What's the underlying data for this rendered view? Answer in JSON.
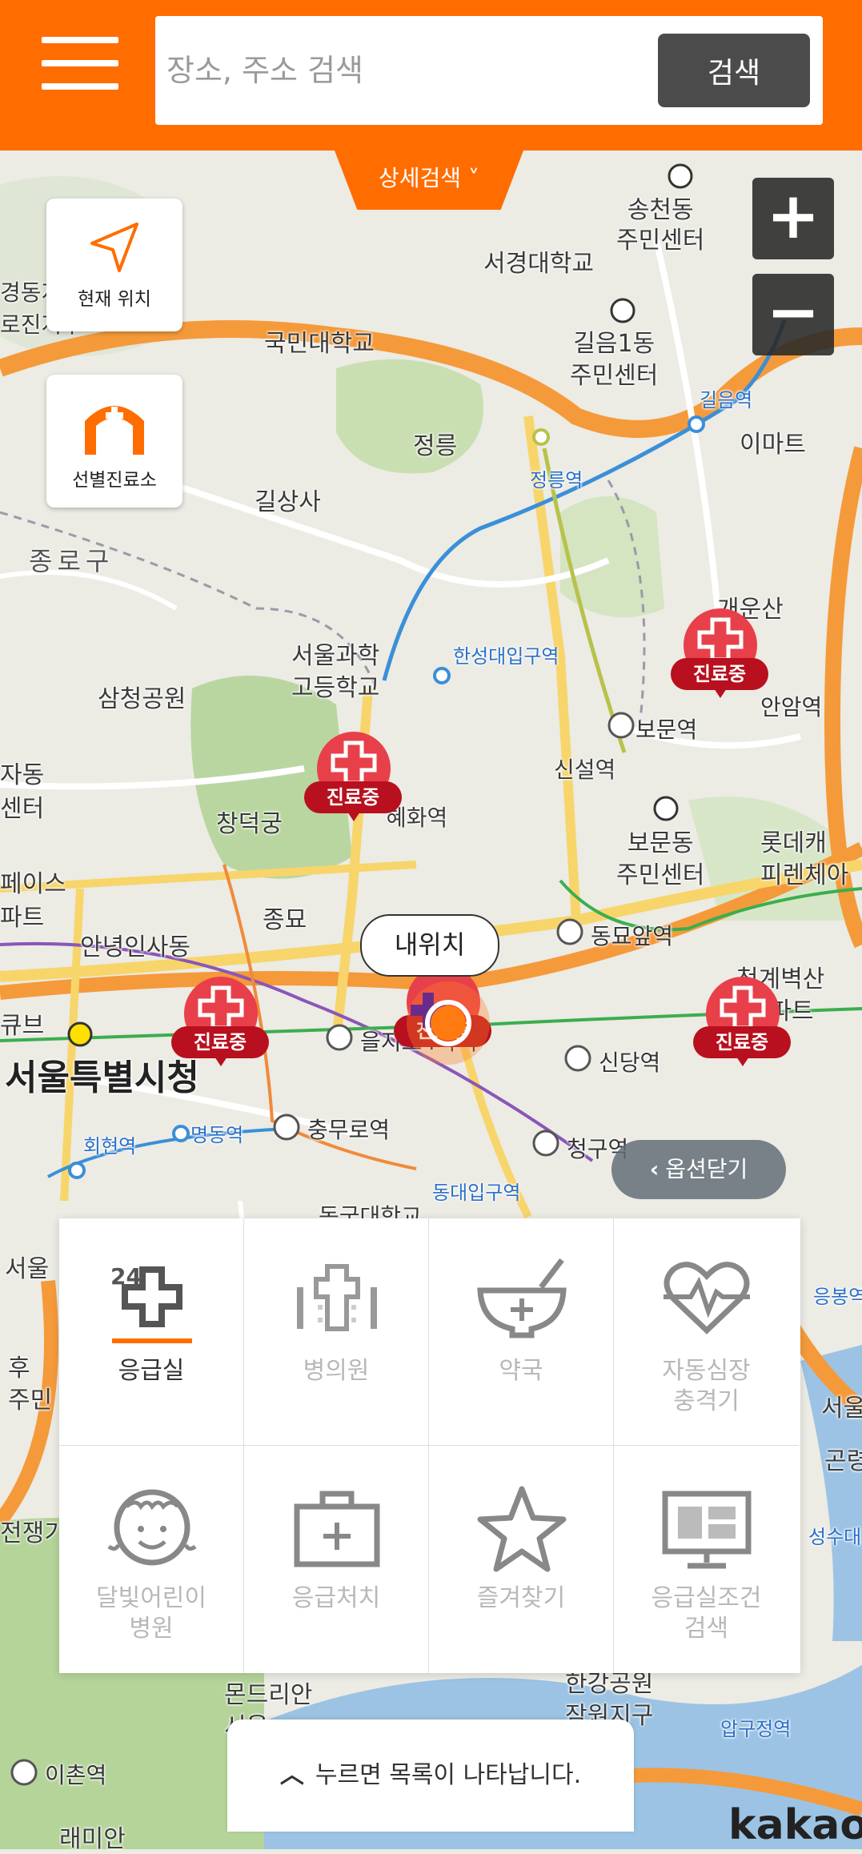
{
  "search": {
    "placeholder": "장소, 주소 검색",
    "button": "검색"
  },
  "detail_search": "상세검색 ˅",
  "side_buttons": {
    "current_location": "현재 위치",
    "screening_clinic": "선별진료소"
  },
  "zoom": {
    "in": "+",
    "out": "−"
  },
  "map_labels": {
    "songcheon": "송천동\n주민센터",
    "seogyeong": "서경대학교",
    "kookmin": "국민대학교",
    "gileum1": "길음1동\n주민센터",
    "jeongneung": "정릉",
    "jeongneung_stn": "정릉역",
    "gileum_stn": "길음역",
    "emart": "이마트",
    "gilsangsa": "길상사",
    "jongno_gu": "종로구",
    "gaeunsan": "개운산",
    "seoul_sci_hs": "서울과학\n고등학교",
    "samcheong_park": "삼청공원",
    "hansung_stn": "한성대입구역",
    "bomun_stn": "보문역",
    "anam_stn": "안암역",
    "changdeokgung": "창덕궁",
    "hyehwa_stn": "혜화역",
    "sinseol_stn": "신설역",
    "bomun_center": "보문동\n주민센터",
    "lotte_castle": "롯데캐\n피렌체아",
    "jongmyo": "종묘",
    "anyeong_insadong": "안녕인사동",
    "dongmyo_stn": "동묘앞역",
    "cheonggye_apt": "청계벽산\n아파트",
    "euljiro_stn": "을지로4가역",
    "sindang_stn": "신당역",
    "seoul_city": "서울특별시청",
    "chungmuro_stn": "충무로역",
    "hoehyeon_stn": "회현역",
    "myeongdong_stn": "명동역",
    "cheonggu_stn": "청구역",
    "dongguk": "동국대학교",
    "dongdae_stn": "동대입구역",
    "seoul_left": "서울",
    "hu_left": "후\n주민",
    "jeonjaeng": "전쟁기",
    "mondrian": "몬드리안\n서울",
    "jamwon": "한강공원\n잠원지구",
    "ichon_stn": "이촌역",
    "raemian": "래미안",
    "apgujeong_stn": "압구정역",
    "seoul_right": "서울",
    "gong_right": "곤령",
    "seongsu_bridge": "성수대교",
    "yongbi": "응봉역",
    "left_dong": "자동\n센터",
    "left_face": "페이스\n파트",
    "left_cube": "큐브",
    "left_fiji": "경동지\n로진지구"
  },
  "clinic_markers": [
    "진료중",
    "진료중",
    "진료중",
    "진료중",
    "진료중"
  ],
  "my_location": "내위치",
  "option_close": "옵션닫기",
  "categories": [
    {
      "label": "응급실",
      "icon": "emergency-24-icon",
      "active": true
    },
    {
      "label": "병의원",
      "icon": "hospital-icon",
      "active": false
    },
    {
      "label": "약국",
      "icon": "pharmacy-icon",
      "active": false
    },
    {
      "label": "자동심장\n충격기",
      "icon": "defibrillator-icon",
      "active": false
    },
    {
      "label": "달빛어린이\n병원",
      "icon": "child-hospital-icon",
      "active": false
    },
    {
      "label": "응급처치",
      "icon": "first-aid-kit-icon",
      "active": false
    },
    {
      "label": "즐겨찾기",
      "icon": "star-icon",
      "active": false
    },
    {
      "label": "응급실조건\n검색",
      "icon": "condition-search-icon",
      "active": false
    }
  ],
  "list_toggle": "누르면 목록이 나타납니다.",
  "brand": "kakao",
  "colors": {
    "accent": "#ff6d00",
    "clinic_red": "#e8404a",
    "search_button": "#4b4b4b"
  }
}
